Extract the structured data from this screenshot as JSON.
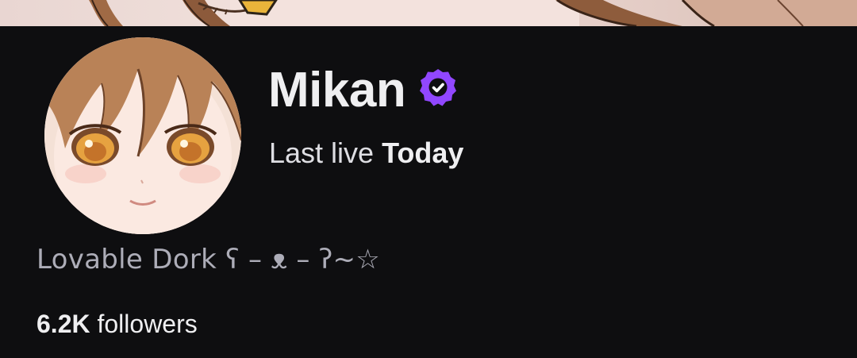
{
  "channel": {
    "name": "Mikan",
    "verified_icon": "verified-badge-icon",
    "last_live_label": "Last live",
    "last_live_value": "Today",
    "bio": "Lovable Dork ʕ – ᴥ – ʔ~☆",
    "followers_count": "6.2K",
    "followers_label": "followers"
  },
  "colors": {
    "background": "#0e0e10",
    "text_primary": "#efeff1",
    "text_secondary": "#adadb8",
    "verified_purple": "#9147ff"
  },
  "images": {
    "banner": "banner-artwork",
    "avatar": "avatar-anime-character"
  }
}
